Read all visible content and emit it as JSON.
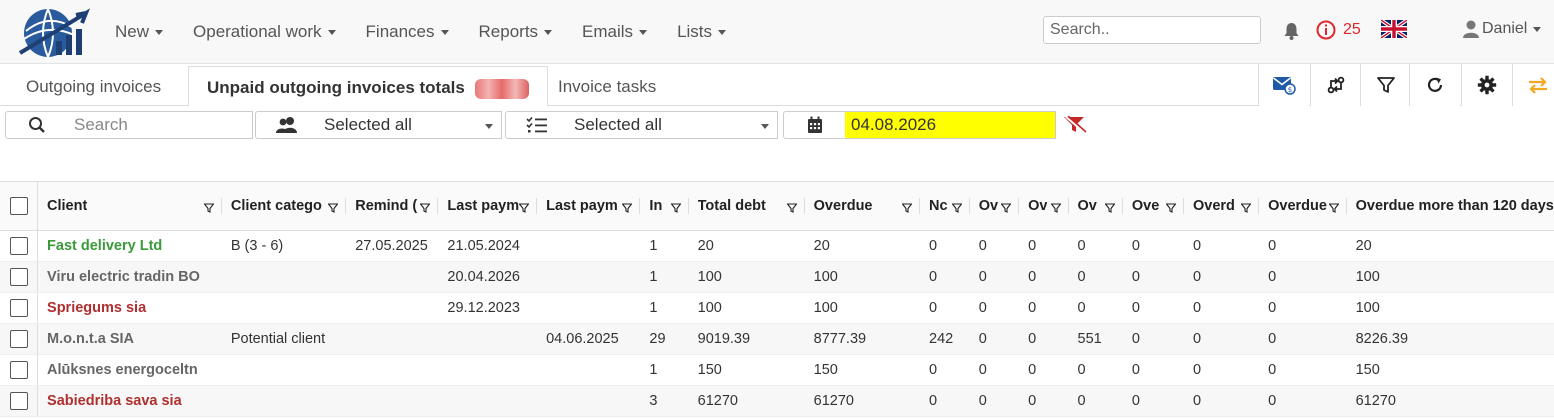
{
  "nav": {
    "items": [
      {
        "label": "New",
        "name": "nav-new"
      },
      {
        "label": "Operational work",
        "name": "nav-operational-work"
      },
      {
        "label": "Finances",
        "name": "nav-finances"
      },
      {
        "label": "Reports",
        "name": "nav-reports"
      },
      {
        "label": "Emails",
        "name": "nav-emails"
      },
      {
        "label": "Lists",
        "name": "nav-lists"
      }
    ],
    "search_placeholder": "Search..",
    "notification_count": "25",
    "user_name": "Daniel"
  },
  "tabs": {
    "outgoing": "Outgoing invoices",
    "unpaid_totals": "Unpaid outgoing invoices totals",
    "tasks": "Invoice tasks"
  },
  "filters": {
    "search_placeholder": "Search",
    "clients_value": "Selected all",
    "categories_value": "Selected all",
    "date_value": "04.08.2026"
  },
  "colors": {
    "accent_orange": "#f5a623",
    "date_highlight": "#ffff00",
    "alert_red": "#e0262f"
  },
  "table": {
    "columns": [
      {
        "label": "Client",
        "width": 186
      },
      {
        "label": "Client catego",
        "width": 126
      },
      {
        "label": "Remind (",
        "width": 93
      },
      {
        "label": "Last paym",
        "width": 100
      },
      {
        "label": "Last paym",
        "width": 105
      },
      {
        "label": "In",
        "width": 50
      },
      {
        "label": "Total debt",
        "width": 119
      },
      {
        "label": "Overdue",
        "width": 119
      },
      {
        "label": "Nc",
        "width": 51
      },
      {
        "label": "Ov",
        "width": 51
      },
      {
        "label": "Ov",
        "width": 51
      },
      {
        "label": "Ov",
        "width": 56
      },
      {
        "label": "Ove",
        "width": 63
      },
      {
        "label": "Overd",
        "width": 77
      },
      {
        "label": "Overdue",
        "width": 89
      },
      {
        "label": "Overdue more than 120 days",
        "width": 180
      }
    ],
    "rows": [
      {
        "client": "Fast delivery Ltd",
        "color": "green",
        "cells": [
          "B (3 - 6)",
          "27.05.2025",
          "21.05.2024",
          "",
          "1",
          "20",
          "20",
          "0",
          "0",
          "0",
          "0",
          "0",
          "0",
          "0",
          "20"
        ]
      },
      {
        "client": "Viru electric tradin BO",
        "color": "gray",
        "cells": [
          "",
          "",
          "20.04.2026",
          "",
          "1",
          "100",
          "100",
          "0",
          "0",
          "0",
          "0",
          "0",
          "0",
          "0",
          "100"
        ]
      },
      {
        "client": "Spriegums sia",
        "color": "red",
        "cells": [
          "",
          "",
          "29.12.2023",
          "",
          "1",
          "100",
          "100",
          "0",
          "0",
          "0",
          "0",
          "0",
          "0",
          "0",
          "100"
        ]
      },
      {
        "client": "M.o.n.t.a SIA",
        "color": "gray",
        "cells": [
          "Potential client",
          "",
          "",
          "04.06.2025",
          "29",
          "9019.39",
          "8777.39",
          "242",
          "0",
          "0",
          "551",
          "0",
          "0",
          "0",
          "8226.39"
        ]
      },
      {
        "client": "Alūksnes energoceltn",
        "color": "gray",
        "cells": [
          "",
          "",
          "",
          "",
          "1",
          "150",
          "150",
          "0",
          "0",
          "0",
          "0",
          "0",
          "0",
          "0",
          "150"
        ]
      },
      {
        "client": "Sabiedriba sava sia",
        "color": "red",
        "cells": [
          "",
          "",
          "",
          "",
          "3",
          "61270",
          "61270",
          "0",
          "0",
          "0",
          "0",
          "0",
          "0",
          "0",
          "61270"
        ]
      }
    ]
  }
}
